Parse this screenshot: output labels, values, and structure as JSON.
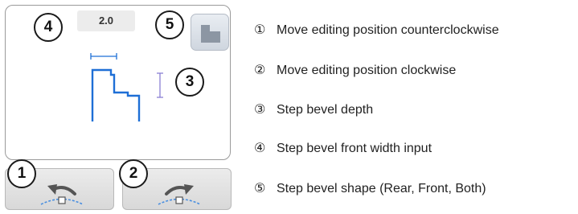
{
  "panel": {
    "width_value": "2.0"
  },
  "callouts": [
    "1",
    "2",
    "3",
    "4",
    "5"
  ],
  "legend": [
    {
      "num": "①",
      "text": "Move editing position counterclockwise"
    },
    {
      "num": "②",
      "text": "Move editing position clockwise"
    },
    {
      "num": "③",
      "text": "Step bevel depth"
    },
    {
      "num": "④",
      "text": "Step bevel front width input"
    },
    {
      "num": "⑤",
      "text": "Step bevel shape (Rear, Front, Both)"
    }
  ],
  "icons": {
    "ccw_button": "rotate-counterclockwise-icon",
    "cw_button": "rotate-clockwise-icon",
    "shape_button": "step-bevel-shape-icon"
  },
  "colors": {
    "profile": "#1e6fd6",
    "depth_marker": "#8a7fd4",
    "arrow": "#555555",
    "track": "#4a8fe0"
  }
}
